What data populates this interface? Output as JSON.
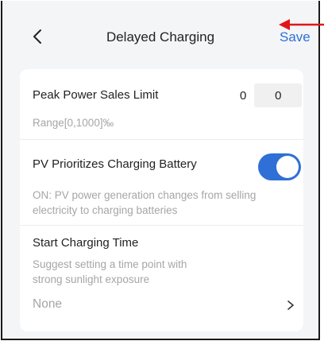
{
  "header": {
    "title": "Delayed Charging",
    "back_icon": "chevron-left-icon",
    "save_label": "Save"
  },
  "colors": {
    "accent": "#2f6fd6",
    "annotation_arrow": "#e0161b",
    "hint_text": "#a6a6a6",
    "background": "#f4f5f7"
  },
  "peak_power": {
    "label": "Peak Power Sales Limit",
    "prefix_value": "0",
    "input_value": "0",
    "range_hint": "Range[0,1000]‰"
  },
  "pv_priority": {
    "label": "PV Prioritizes Charging Battery",
    "enabled": true,
    "hint_line1": "ON: PV power generation changes from selling",
    "hint_line2": "electricity to charging batteries"
  },
  "start_time": {
    "label": "Start Charging Time",
    "hint_line1": "Suggest setting a time point with",
    "hint_line2": "strong sunlight exposure",
    "value": "None",
    "chevron_icon": "chevron-right-icon"
  }
}
